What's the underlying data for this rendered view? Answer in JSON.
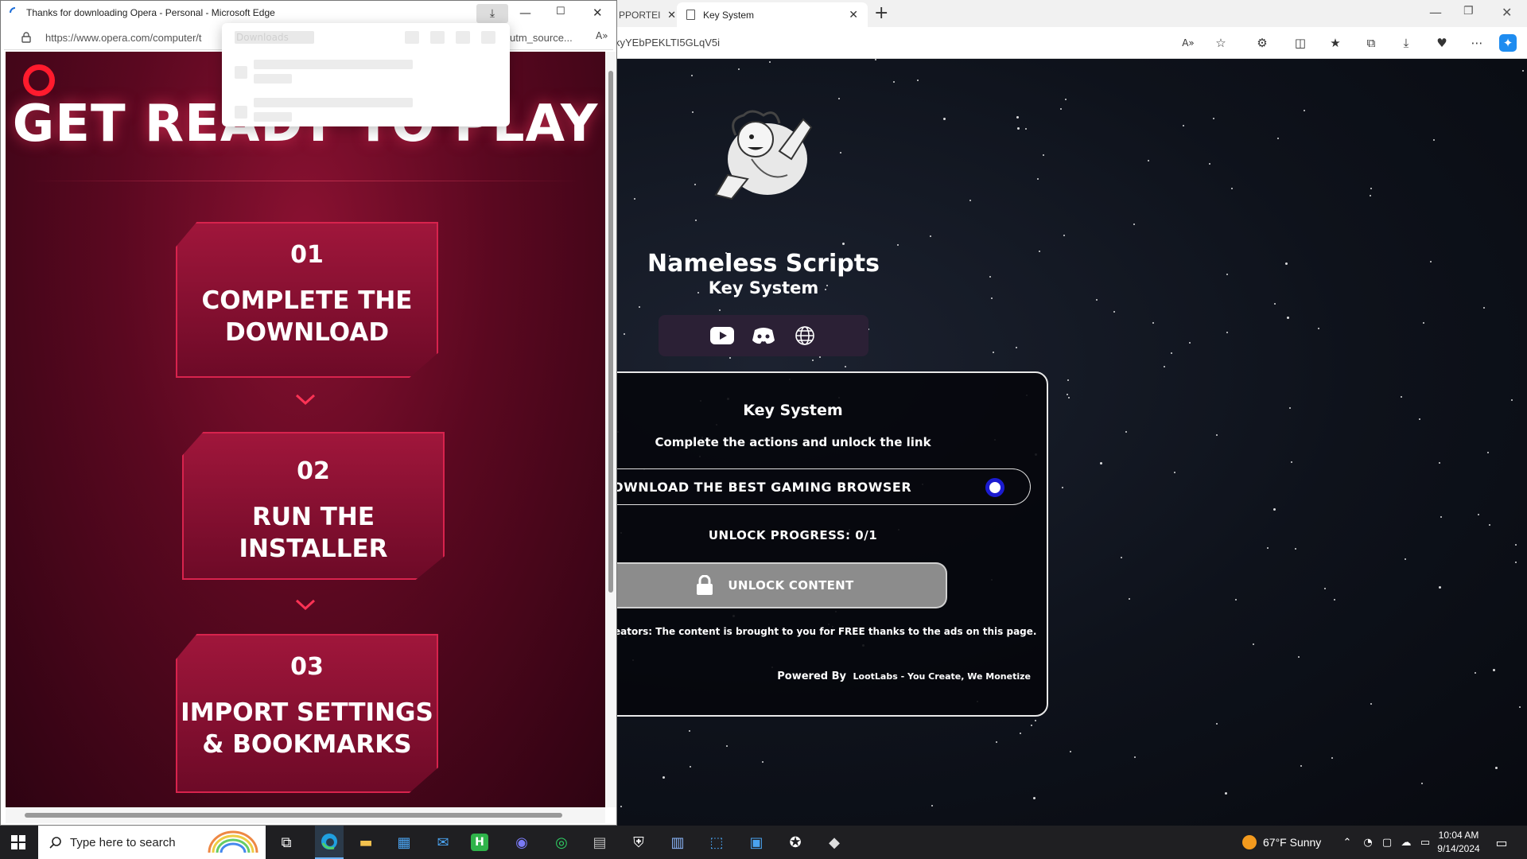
{
  "background_window": {
    "tabs": [
      {
        "label": "PPORTEI"
      },
      {
        "label": "Key System"
      }
    ],
    "url": "kyYEbPEKLTI5GLqV5i",
    "site": {
      "title": "Nameless Scripts",
      "subtitle": "Key System"
    },
    "card": {
      "title": "Key System",
      "description": "Complete the actions and unlock the link",
      "task_label": "OWNLOAD THE BEST GAMING BROWSER",
      "progress": "UNLOCK PROGRESS: 0/1",
      "unlock_label": "UNLOCK CONTENT",
      "ad_note": "eators: The content is brought to you for FREE thanks to the ads on this page.",
      "powered_by": "Powered By",
      "powered_link": "LootLabs - You Create, We Monetize"
    }
  },
  "foreground_window": {
    "title": "Thanks for downloading Opera - Personal - Microsoft Edge",
    "url": "https://www.opera.com/computer/t",
    "url_tail": "utm_source...",
    "downloads_heading": "Downloads",
    "hero": "GET READY TO PLAY",
    "steps": [
      {
        "num": "01",
        "line1": "COMPLETE THE",
        "line2": "DOWNLOAD"
      },
      {
        "num": "02",
        "line1": "RUN THE",
        "line2": "INSTALLER"
      },
      {
        "num": "03",
        "line1": "IMPORT SETTINGS",
        "line2": "& BOOKMARKS"
      }
    ]
  },
  "taskbar": {
    "search_placeholder": "Type here to search",
    "weather": "67°F  Sunny",
    "time": "10:04 AM",
    "date": "9/14/2024"
  },
  "colors": {
    "opera_red": "#ff1b2d",
    "radio_blue": "#1b1bd0",
    "unlock_gray": "#8c8c8c"
  }
}
